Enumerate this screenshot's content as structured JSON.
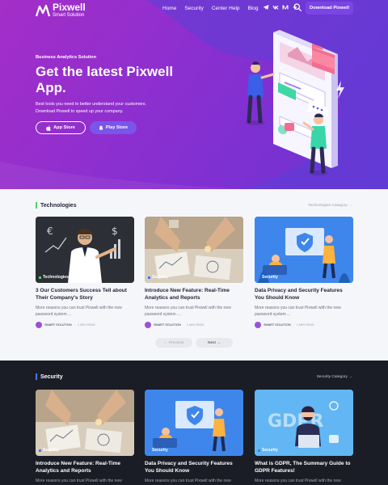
{
  "brand": {
    "name": "Pixwell",
    "tagline": "Smart Solution"
  },
  "nav": {
    "items": [
      "Home",
      "Security",
      "Center Help",
      "Blog"
    ],
    "download_label": "Download Pixwell",
    "social_icons": [
      "telegram-icon",
      "vk-icon",
      "medium-icon",
      "bolt-icon"
    ]
  },
  "hero": {
    "kicker": "Business Analytics Solution",
    "headline": "Get the latest Pixwell App.",
    "description": "Best tools you need to better understand your customers. Download Pixwell to speed up your company.",
    "app_store_label": "App Store",
    "play_store_label": "Play Store"
  },
  "technologies": {
    "title": "Technologies",
    "link": "Technologies Category",
    "cards": [
      {
        "tag": "Technologies",
        "title": "3 Our Customers Success Tell about Their Company's Story",
        "excerpt": "More reasons you can trust Pixwell with the new password system ...",
        "author": "SMART SOLUTION",
        "read": "1 MIN READ"
      },
      {
        "tag": "Security",
        "title": "Introduce New Feature: Real-Time Analytics and Reports",
        "excerpt": "More reasons you can trust Pixwell with the new password system ...",
        "author": "SMART SOLUTION",
        "read": "1 MIN READ"
      },
      {
        "tag": "Security",
        "title": "Data Privacy and Security Features You Should Know",
        "excerpt": "More reasons you can trust Pixwell with the new password system ...",
        "author": "SMART SOLUTION",
        "read": "1 MIN READ"
      }
    ],
    "prev_label": "← Previous",
    "next_label": "Next →"
  },
  "security": {
    "title": "Security",
    "link": "Security Category",
    "cards": [
      {
        "tag": "Security",
        "title": "Introduce New Feature: Real-Time Analytics and Reports",
        "excerpt": "More reasons you can trust Pixwell with the new"
      },
      {
        "tag": "Security",
        "title": "Data Privacy and Security Features You Should Know",
        "excerpt": "More reasons you can trust Pixwell with the new"
      },
      {
        "tag": "Security",
        "title": "What is GDPR, The Summary Guide to GDPR Features!",
        "excerpt": "More reasons you can trust Pixwell with the new"
      }
    ]
  },
  "colors": {
    "brand_purple": "#7b45e6",
    "hero_start": "#a42ec8",
    "hero_end": "#6a33d4",
    "tech_accent": "#44d46b",
    "security_accent": "#3d7bff",
    "dark_bg": "#1a1d26"
  }
}
